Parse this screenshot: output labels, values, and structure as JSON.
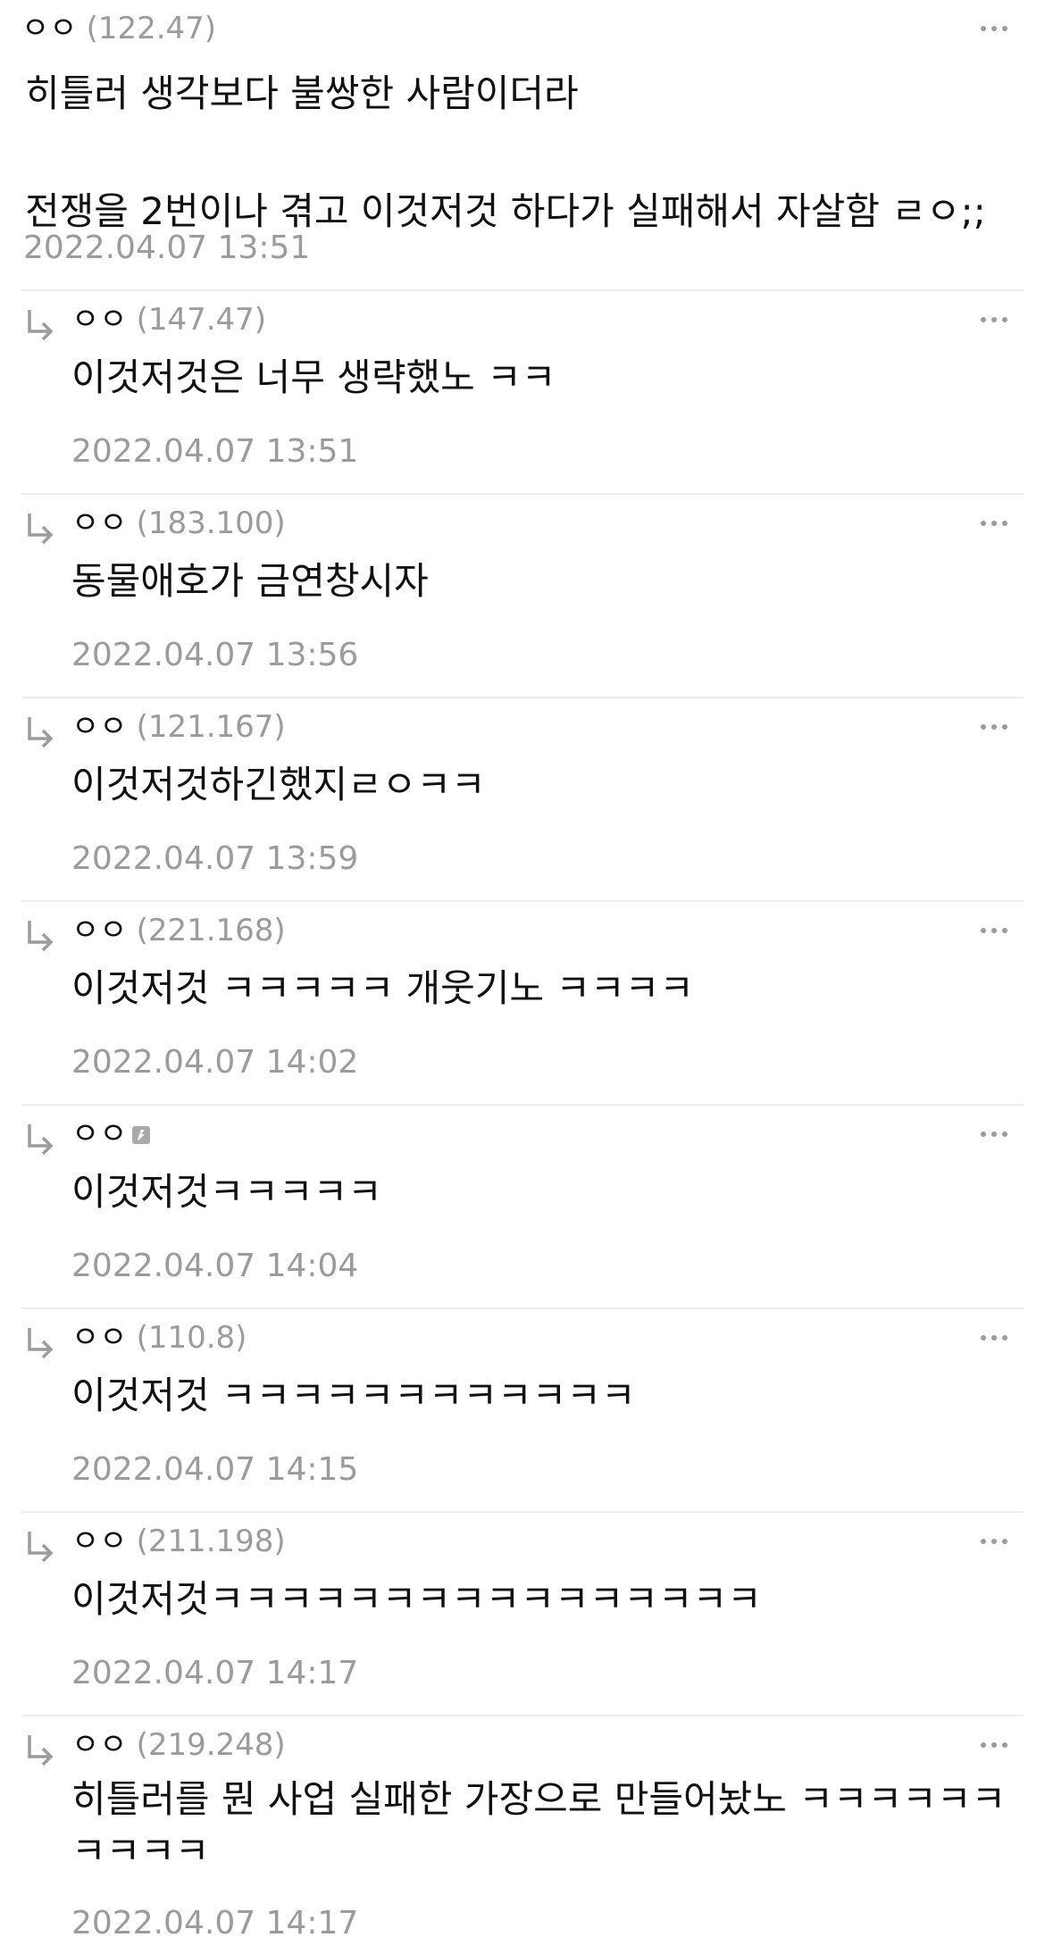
{
  "comments": [
    {
      "nickname": "ㅇㅇ",
      "ip": "(122.47)",
      "text": "히틀러 생각보다 불쌍한 사람이더라\n\n전쟁을 2번이나 겪고 이것저것 하다가 실패해서 자살함 ㄹㅇ;;",
      "date": "2022.04.07 13:51"
    },
    {
      "nickname": "ㅇㅇ",
      "ip": "(147.47)",
      "text": "이것저것은 너무 생략했노 ㅋㅋ",
      "date": "2022.04.07 13:51"
    },
    {
      "nickname": "ㅇㅇ",
      "ip": "(183.100)",
      "text": "동물애호가 금연창시자",
      "date": "2022.04.07 13:56"
    },
    {
      "nickname": "ㅇㅇ",
      "ip": "(121.167)",
      "text": "이것저것하긴했지ㄹㅇㅋㅋ",
      "date": "2022.04.07 13:59"
    },
    {
      "nickname": "ㅇㅇ",
      "ip": "(221.168)",
      "text": "이것저것 ㅋㅋㅋㅋㅋ 개웃기노 ㅋㅋㅋㅋ",
      "date": "2022.04.07 14:02"
    },
    {
      "nickname": "ㅇㅇ",
      "ip": "",
      "text": "이것저것ㅋㅋㅋㅋㅋ",
      "date": "2022.04.07 14:04"
    },
    {
      "nickname": "ㅇㅇ",
      "ip": "(110.8)",
      "text": "이것저것 ㅋㅋㅋㅋㅋㅋㅋㅋㅋㅋㅋㅋ",
      "date": "2022.04.07 14:15"
    },
    {
      "nickname": "ㅇㅇ",
      "ip": "(211.198)",
      "text": "이것저것ㅋㅋㅋㅋㅋㅋㅋㅋㅋㅋㅋㅋㅋㅋㅋㅋ",
      "date": "2022.04.07 14:17"
    },
    {
      "nickname": "ㅇㅇ",
      "ip": "(219.248)",
      "text": "히틀러를 뭔 사업 실패한 가장으로 만들어놨노 ㅋㅋㅋㅋㅋㅋ\nㅋㅋㅋㅋ",
      "date": "2022.04.07 14:17"
    }
  ],
  "colors": {
    "text": "#111111",
    "muted": "#9b9b9b",
    "divider": "#ececec"
  },
  "icons": {
    "reply": "reply-arrow-icon",
    "more": "more-options-icon",
    "badge": "fixed-nick-badge-icon"
  }
}
